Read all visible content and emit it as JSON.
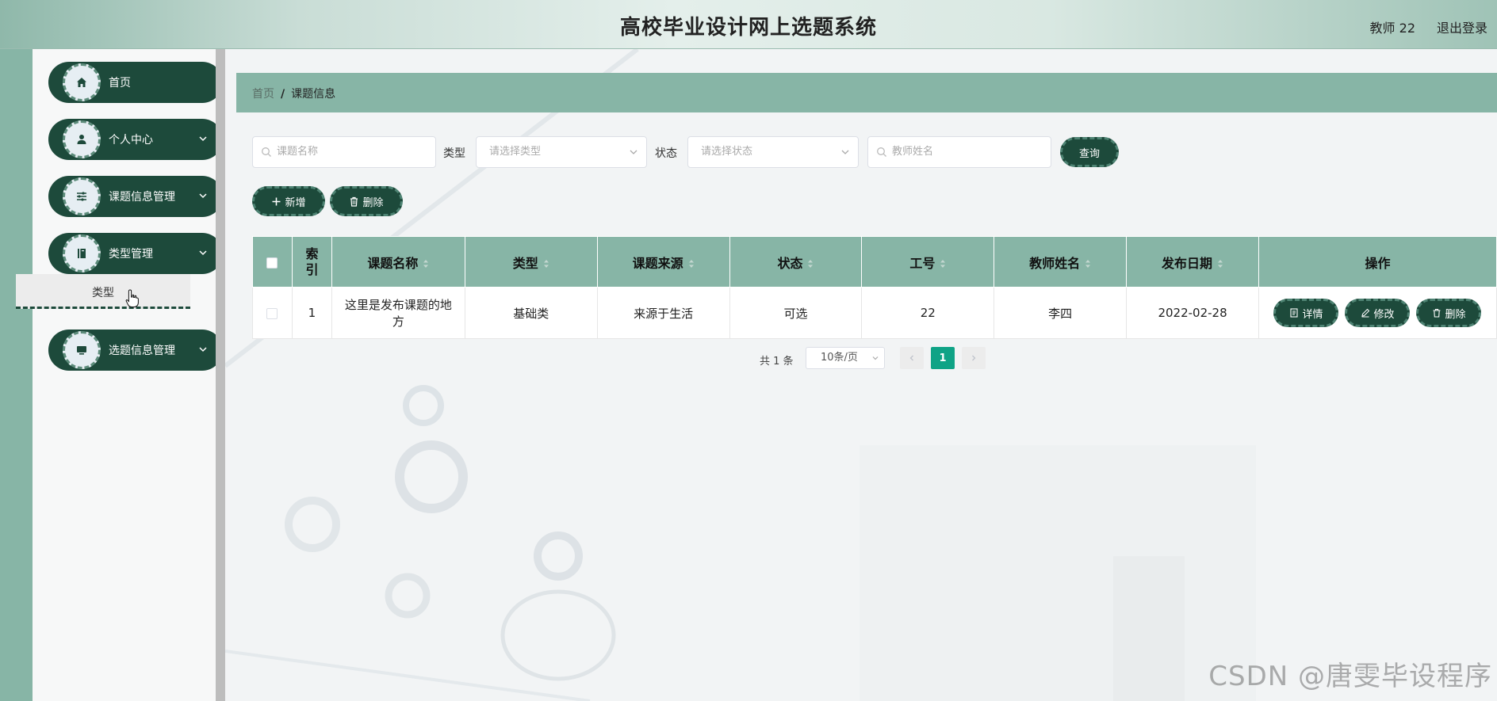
{
  "header": {
    "title": "高校毕业设计网上选题系统",
    "user": "教师 22",
    "logout": "退出登录"
  },
  "sidebar": {
    "items": [
      {
        "label": "首页",
        "icon": "home-icon"
      },
      {
        "label": "个人中心",
        "icon": "person-icon"
      },
      {
        "label": "课题信息管理",
        "icon": "sliders-icon"
      },
      {
        "label": "类型管理",
        "icon": "book-icon"
      },
      {
        "label": "选题信息管理",
        "icon": "monitor-icon"
      }
    ],
    "submenu": {
      "label": "类型"
    }
  },
  "breadcrumb": {
    "home": "首页",
    "separator": "/",
    "current": "课题信息"
  },
  "search": {
    "name_placeholder": "课题名称",
    "type_label": "类型",
    "type_placeholder": "请选择类型",
    "status_label": "状态",
    "status_placeholder": "请选择状态",
    "teacher_placeholder": "教师姓名",
    "query_button": "查询"
  },
  "toolbar": {
    "add_label": "新增",
    "delete_label": "删除"
  },
  "table": {
    "headers": [
      "索引",
      "课题名称",
      "类型",
      "课题来源",
      "状态",
      "工号",
      "教师姓名",
      "发布日期",
      "操作"
    ],
    "rows": [
      {
        "index": "1",
        "name": "这里是发布课题的地方",
        "type": "基础类",
        "source": "来源于生活",
        "status": "可选",
        "job_no": "22",
        "teacher": "李四",
        "date": "2022-02-28"
      }
    ],
    "actions": {
      "detail": "详情",
      "edit": "修改",
      "delete": "删除"
    }
  },
  "pagination": {
    "total": "共 1 条",
    "page_size": "10条/页",
    "current_page": "1"
  },
  "watermark": "CSDN @唐雯毕设程序",
  "colors": {
    "dark_green": "#1d4a3b",
    "mint": "#87b5a6",
    "active_page": "#0fa386"
  }
}
